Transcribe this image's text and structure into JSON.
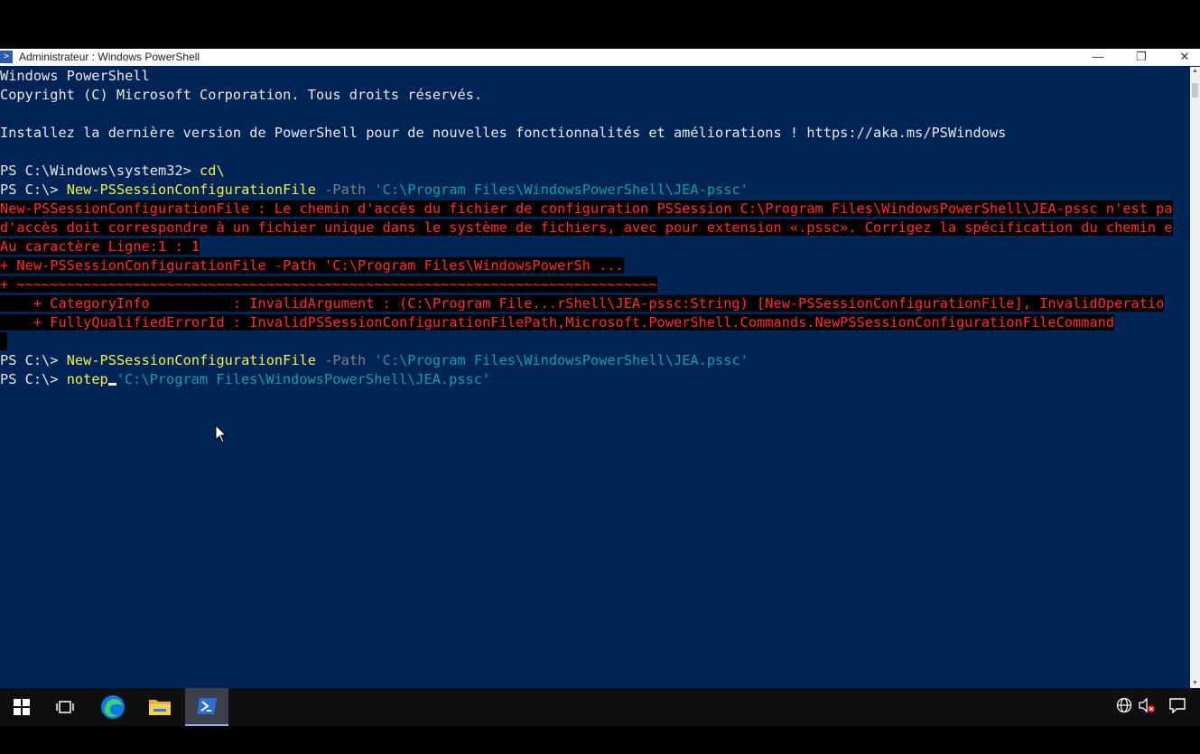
{
  "window": {
    "title": "Administrateur : Windows PowerShell",
    "controls": {
      "minimize": "—",
      "maximize": "❐",
      "close": "✕"
    }
  },
  "console": {
    "lines": {
      "l1": "Windows PowerShell",
      "l2": "Copyright (C) Microsoft Corporation. Tous droits réservés.",
      "l3": "Installez la dernière version de PowerShell pour de nouvelles fonctionnalités et améliorations ! https://aka.ms/PSWindows",
      "l4_prompt": "PS C:\\Windows\\system32> ",
      "l4_cmd": "cd\\",
      "l5_prompt": "PS C:\\> ",
      "l5_cmd": "New-PSSessionConfigurationFile",
      "l5_param": " -Path ",
      "l5_str": "'C:\\Program Files\\WindowsPowerShell\\JEA-pssc'",
      "e1": "New-PSSessionConfigurationFile : Le chemin d'accès du fichier de configuration PSSession C:\\Program Files\\WindowsPowerShell\\JEA-pssc n'est pa",
      "e2": "d'accès doit correspondre à un fichier unique dans le système de fichiers, avec pour extension «.pssc». Corrigez la spécification du chemin e",
      "e3": "Au caractère Ligne:1 : 1",
      "e4": "+ New-PSSessionConfigurationFile -Path 'C:\\Program Files\\WindowsPowerSh ...",
      "e5": "+ ~~~~~~~~~~~~~~~~~~~~~~~~~~~~~~~~~~~~~~~~~~~~~~~~~~~~~~~~~~~~~~~~~~~~~~~~~~~~~",
      "e6": "    + CategoryInfo          : InvalidArgument : (C:\\Program File...rShell\\JEA-pssc:String) [New-PSSessionConfigurationFile], InvalidOperatio",
      "e7": "    + FullyQualifiedErrorId : InvalidPSSessionConfigurationFilePath,Microsoft.PowerShell.Commands.NewPSSessionConfigurationFileCommand",
      "l6_prompt": "PS C:\\> ",
      "l6_cmd": "New-PSSessionConfigurationFile",
      "l6_param": " -Path ",
      "l6_str": "'C:\\Program Files\\WindowsPowerShell\\JEA.pssc'",
      "l7_prompt": "PS C:\\> ",
      "l7_cmd": "notep",
      "l7_str": "'C:\\Program Files\\WindowsPowerShell\\JEA.pssc'"
    }
  },
  "taskbar": {
    "items": [
      {
        "name": "start-icon"
      },
      {
        "name": "task-view-icon"
      },
      {
        "name": "edge-icon"
      },
      {
        "name": "file-explorer-icon"
      },
      {
        "name": "powershell-icon",
        "active": true
      }
    ],
    "tray": [
      {
        "name": "network-icon",
        "glyph": "🌐"
      },
      {
        "name": "volume-muted-icon",
        "glyph": "🔇"
      },
      {
        "name": "notifications-icon",
        "glyph": "🗨"
      }
    ]
  },
  "colors": {
    "console_bg": "#012456",
    "command": "#f2f24c",
    "parameter": "#7f7f7f",
    "string": "#0fa0a0",
    "error": "#ff3030"
  }
}
